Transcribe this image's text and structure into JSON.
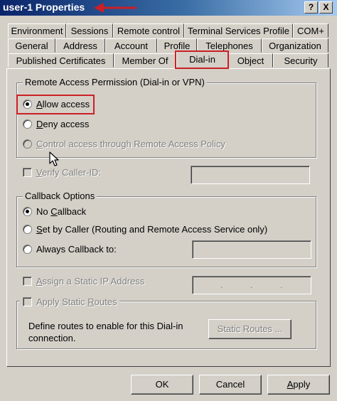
{
  "window": {
    "title": "user-1 Properties",
    "help_button": "?",
    "close_button": "X"
  },
  "tabs": {
    "row1": [
      "Environment",
      "Sessions",
      "Remote control",
      "Terminal Services Profile",
      "COM+"
    ],
    "row2": [
      "General",
      "Address",
      "Account",
      "Profile",
      "Telephones",
      "Organization"
    ],
    "row3": [
      "Published Certificates",
      "Member Of",
      "Dial-in",
      "Object",
      "Security"
    ],
    "active": "Dial-in"
  },
  "remote_access": {
    "legend": "Remote Access Permission (Dial-in or VPN)",
    "allow": {
      "prefix": "",
      "hot": "A",
      "rest": "llow access",
      "selected": true
    },
    "deny": {
      "prefix": "",
      "hot": "D",
      "rest": "eny access",
      "selected": false
    },
    "policy": {
      "prefix": "",
      "hot": "C",
      "rest": "ontrol access through Remote Access Policy",
      "disabled": true
    }
  },
  "verify_caller_id": {
    "prefix": "",
    "hot": "V",
    "rest": "erify Caller-ID:",
    "disabled": true,
    "value": ""
  },
  "callback": {
    "legend": "Callback Options",
    "no_callback": {
      "prefix": "No ",
      "hot": "C",
      "rest": "allback",
      "selected": true
    },
    "set_by_caller": {
      "prefix": "",
      "hot": "S",
      "rest": "et by Caller (Routing and Remote Access Service only)",
      "selected": false
    },
    "always": {
      "prefix": "Always Callback to:",
      "hot": "",
      "rest": "",
      "selected": false,
      "value": ""
    }
  },
  "static_ip": {
    "prefix": "",
    "hot": "A",
    "rest": "ssign a Static IP Address",
    "disabled": true,
    "ip_dots": [
      ".",
      ".",
      "."
    ]
  },
  "static_routes": {
    "prefix": "Apply Static ",
    "hot": "R",
    "rest": "outes",
    "disabled": true,
    "description": "Define routes to enable for this Dial-in connection.",
    "button": "Static Routes ..."
  },
  "footer": {
    "ok": "OK",
    "cancel": "Cancel",
    "apply": {
      "hot": "A",
      "rest": "pply"
    }
  },
  "colors": {
    "highlight": "#cc1f26",
    "dialog_face": "#d4d0c8",
    "title_active": "#0a246a"
  }
}
